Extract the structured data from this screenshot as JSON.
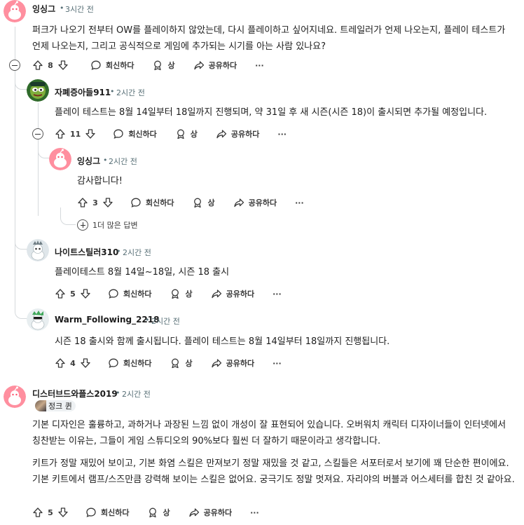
{
  "comments": [
    {
      "author": "잉싱그",
      "time": "3시간 전",
      "body": "퍼크가 나오기 전부터 OW를 플레이하지 않았는데, 다시 플레이하고 싶어지네요. 트레일러가 언제 나오는지, 플레이 테스트가 언제 나오는지, 그리고 공식적으로 게임에 추가되는 시기를 아는 사람 있나요?",
      "votes": "8"
    },
    {
      "author": "자폐증아들911",
      "time": "2시간 전",
      "body": "플레이 테스트는 8월 14일부터 18일까지 진행되며, 약 31일 후 새 시즌(시즌 18)이 출시되면 추가될 예정입니다.",
      "votes": "11"
    },
    {
      "author": "잉싱그",
      "time": "2시간 전",
      "body": "감사합니다!",
      "votes": "3"
    },
    {
      "author": "나이트스틸러310",
      "time": "2시간 전",
      "body": "플레이테스트 8월 14일~18일, 시즌 18 출시",
      "votes": "5"
    },
    {
      "author": "Warm_Following_2218",
      "time": "2시간 전",
      "body": "시즌 18 출시와 함께 출시됩니다. 플레이 테스트는 8월 14일부터 18일까지 진행됩니다.",
      "votes": "4"
    },
    {
      "author": "디스터브드와플스2019",
      "time": "2시간 전",
      "flair": "정크 퀸",
      "body_p1": "기본 디자인은 훌륭하고, 과하거나 과장된 느낌 없이 개성이 잘 표현되어 있습니다. 오버워치 캐릭터 디자이너들이 인터넷에서 칭찬받는 이유는, 그들이 게임 스튜디오의 90%보다 훨씬 더 잘하기 때문이라고 생각합니다.",
      "body_p2": "키트가 정말 재밌어 보이고, 기본 화염 스킬은 만져보기 정말 재밌을 것 같고, 스킬들은 서포터로서 보기에 꽤 단순한 편이에요. 기본 키트에서 램프/스즈만큼 강력해 보이는 스킬은 없어요. 궁극기도 정말 멋져요. 자리야의 버블과 어스세터를 합친 것 같아요.",
      "votes": "5"
    }
  ],
  "actions": {
    "reply": "회신하다",
    "award": "상",
    "share": "공유하다",
    "more": "···",
    "separator": "•"
  },
  "more_replies": "1더 많은 답변",
  "colors": {
    "avatar_pink": "#ff8f9f",
    "thread_line": "#d5d9dc",
    "meta_gray": "#576f76"
  },
  "icons": [
    "upvote-icon",
    "downvote-icon",
    "comment-icon",
    "award-icon",
    "share-icon",
    "collapse-icon",
    "plus-icon"
  ]
}
